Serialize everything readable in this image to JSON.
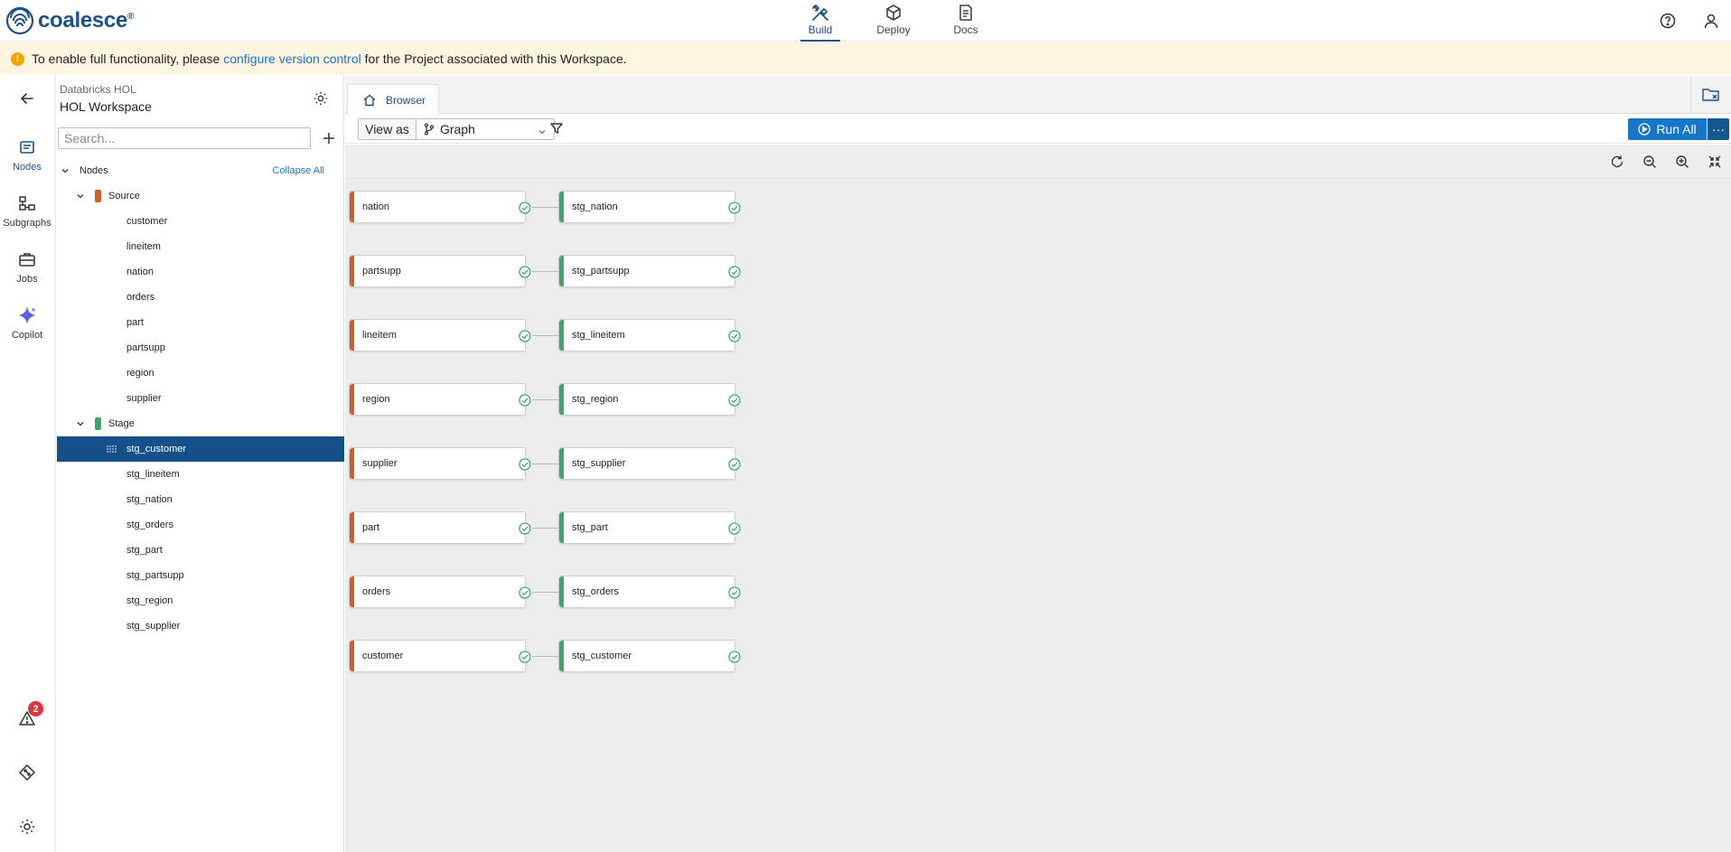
{
  "app": {
    "logo_text": "coalesce"
  },
  "topnav": [
    {
      "label": "Build",
      "icon": "build-icon",
      "active": true
    },
    {
      "label": "Deploy",
      "icon": "deploy-icon",
      "active": false
    },
    {
      "label": "Docs",
      "icon": "docs-icon",
      "active": false
    }
  ],
  "banner": {
    "prefix": "To enable full functionality, please ",
    "link": "configure version control",
    "suffix": " for the Project associated with this Workspace."
  },
  "rail": {
    "nodes": "Nodes",
    "subgraphs": "Subgraphs",
    "jobs": "Jobs",
    "copilot": "Copilot",
    "problems_count": "2"
  },
  "sidebar": {
    "project": "Databricks HOL",
    "workspace": "HOL Workspace",
    "search_placeholder": "Search...",
    "tree_root": "Nodes",
    "collapse_all": "Collapse All",
    "groups": [
      {
        "name": "Source",
        "color": "#d95b1c",
        "items": [
          "customer",
          "lineitem",
          "nation",
          "orders",
          "part",
          "partsupp",
          "region",
          "supplier"
        ]
      },
      {
        "name": "Stage",
        "color": "#3fa66a",
        "items": [
          "stg_customer",
          "stg_lineitem",
          "stg_nation",
          "stg_orders",
          "stg_part",
          "stg_partsupp",
          "stg_region",
          "stg_supplier"
        ]
      }
    ],
    "selected": "stg_customer"
  },
  "tabs": {
    "browser": "Browser"
  },
  "toolbar": {
    "view_as": "View as",
    "view_mode": "Graph",
    "run_all": "Run All",
    "more": "···"
  },
  "graph": {
    "source_color": "#d95b1c",
    "stage_color": "#3fa66a",
    "rows": [
      {
        "source": "nation",
        "stage": "stg_nation"
      },
      {
        "source": "partsupp",
        "stage": "stg_partsupp"
      },
      {
        "source": "lineitem",
        "stage": "stg_lineitem"
      },
      {
        "source": "region",
        "stage": "stg_region"
      },
      {
        "source": "supplier",
        "stage": "stg_supplier"
      },
      {
        "source": "part",
        "stage": "stg_part"
      },
      {
        "source": "orders",
        "stage": "stg_orders"
      },
      {
        "source": "customer",
        "stage": "stg_customer"
      }
    ]
  }
}
